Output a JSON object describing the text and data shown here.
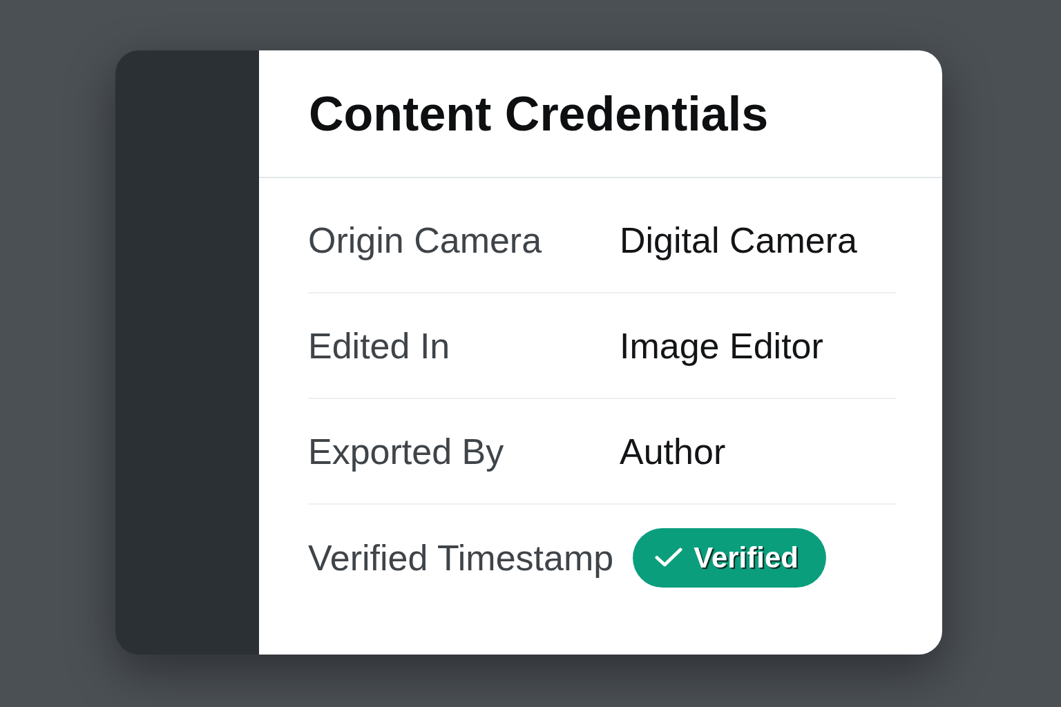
{
  "panel": {
    "title": "Content Credentials"
  },
  "rows": [
    {
      "kind": "text",
      "label": "Origin Camera",
      "value": "Digital Camera"
    },
    {
      "kind": "text",
      "label": "Edited In",
      "value": "Image Editor"
    },
    {
      "kind": "text",
      "label": "Exported By",
      "value": "Author"
    },
    {
      "kind": "badge",
      "label": "Verified Timestamp",
      "value": "Verified"
    }
  ]
}
